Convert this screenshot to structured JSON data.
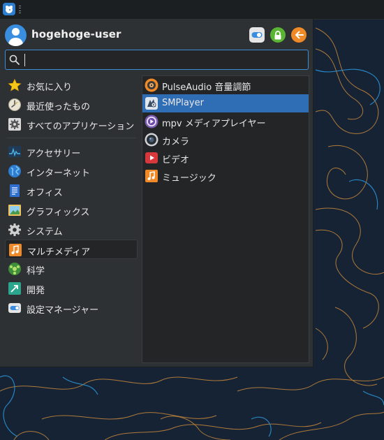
{
  "user": {
    "name": "hogehoge-user"
  },
  "header_buttons": [
    {
      "name": "settings-manager-button",
      "icon": "toggle-icon",
      "color": "#e6e6e6"
    },
    {
      "name": "lock-screen-button",
      "icon": "lock-icon",
      "color": "#5bb534"
    },
    {
      "name": "log-out-button",
      "icon": "arrow-left-icon",
      "color": "#f08a28"
    }
  ],
  "search": {
    "value": "",
    "placeholder": ""
  },
  "categories": [
    {
      "label": "お気に入り",
      "icon": "star-icon"
    },
    {
      "label": "最近使ったもの",
      "icon": "recent-clock-icon"
    },
    {
      "label": "すべてのアプリケーション",
      "icon": "all-apps-gear-icon"
    },
    {
      "label": "アクセサリー",
      "icon": "accessories-icon"
    },
    {
      "label": "インターネット",
      "icon": "globe-icon"
    },
    {
      "label": "オフィス",
      "icon": "document-icon"
    },
    {
      "label": "グラフィックス",
      "icon": "image-icon"
    },
    {
      "label": "システム",
      "icon": "gear-icon"
    },
    {
      "label": "マルチメディア",
      "icon": "music-note-icon"
    },
    {
      "label": "科学",
      "icon": "science-icon"
    },
    {
      "label": "開発",
      "icon": "development-icon"
    },
    {
      "label": "設定マネージャー",
      "icon": "settings-toggle-icon"
    }
  ],
  "active_category": "マルチメディア",
  "apps": [
    {
      "label": "PulseAudio 音量調節",
      "icon": "speaker-icon"
    },
    {
      "label": "SMPlayer",
      "icon": "smplayer-icon"
    },
    {
      "label": "mpv メディアプレイヤー",
      "icon": "mpv-play-icon"
    },
    {
      "label": "カメラ",
      "icon": "camera-icon"
    },
    {
      "label": "ビデオ",
      "icon": "video-icon"
    },
    {
      "label": "ミュージック",
      "icon": "music-icon"
    }
  ],
  "selected_app": "SMPlayer",
  "colors": {
    "accent": "#3e8dd9",
    "selection": "#2f6db5",
    "panel": "#2e3133",
    "desktop": "#162335",
    "contour_orange": "#c98a3a",
    "contour_blue": "#2a8fd0"
  }
}
